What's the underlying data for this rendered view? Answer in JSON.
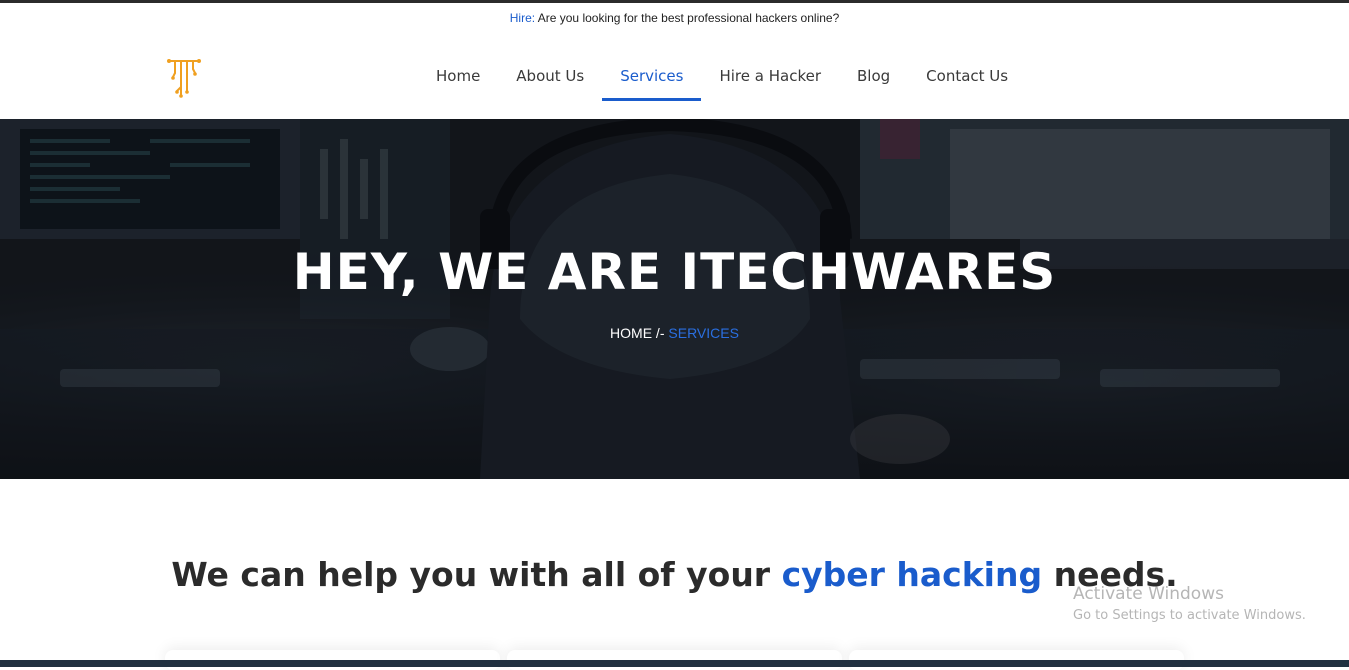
{
  "announcement": {
    "label": "Hire:",
    "text": " Are you looking for the best professional hackers online?"
  },
  "nav": {
    "items": [
      {
        "label": "Home",
        "active": false
      },
      {
        "label": "About Us",
        "active": false
      },
      {
        "label": "Services",
        "active": true
      },
      {
        "label": "Hire a Hacker",
        "active": false
      },
      {
        "label": "Blog",
        "active": false
      },
      {
        "label": "Contact Us",
        "active": false
      }
    ]
  },
  "logo": {
    "icon": "circuit-t-logo-icon",
    "color": "#f0a020"
  },
  "hero": {
    "title": "HEY, WE ARE ITECHWARES",
    "breadcrumb_home": "HOME",
    "breadcrumb_sep": " /- ",
    "breadcrumb_current": "SERVICES"
  },
  "section": {
    "title_start": "We can help you with all of your ",
    "title_accent": "cyber hacking",
    "title_end": " needs."
  },
  "watermark": {
    "line1": "Activate Windows",
    "line2": "Go to Settings to activate Windows."
  },
  "colors": {
    "accent": "#1a5ccc",
    "logo": "#f0a020",
    "text": "#2b2b2b"
  }
}
